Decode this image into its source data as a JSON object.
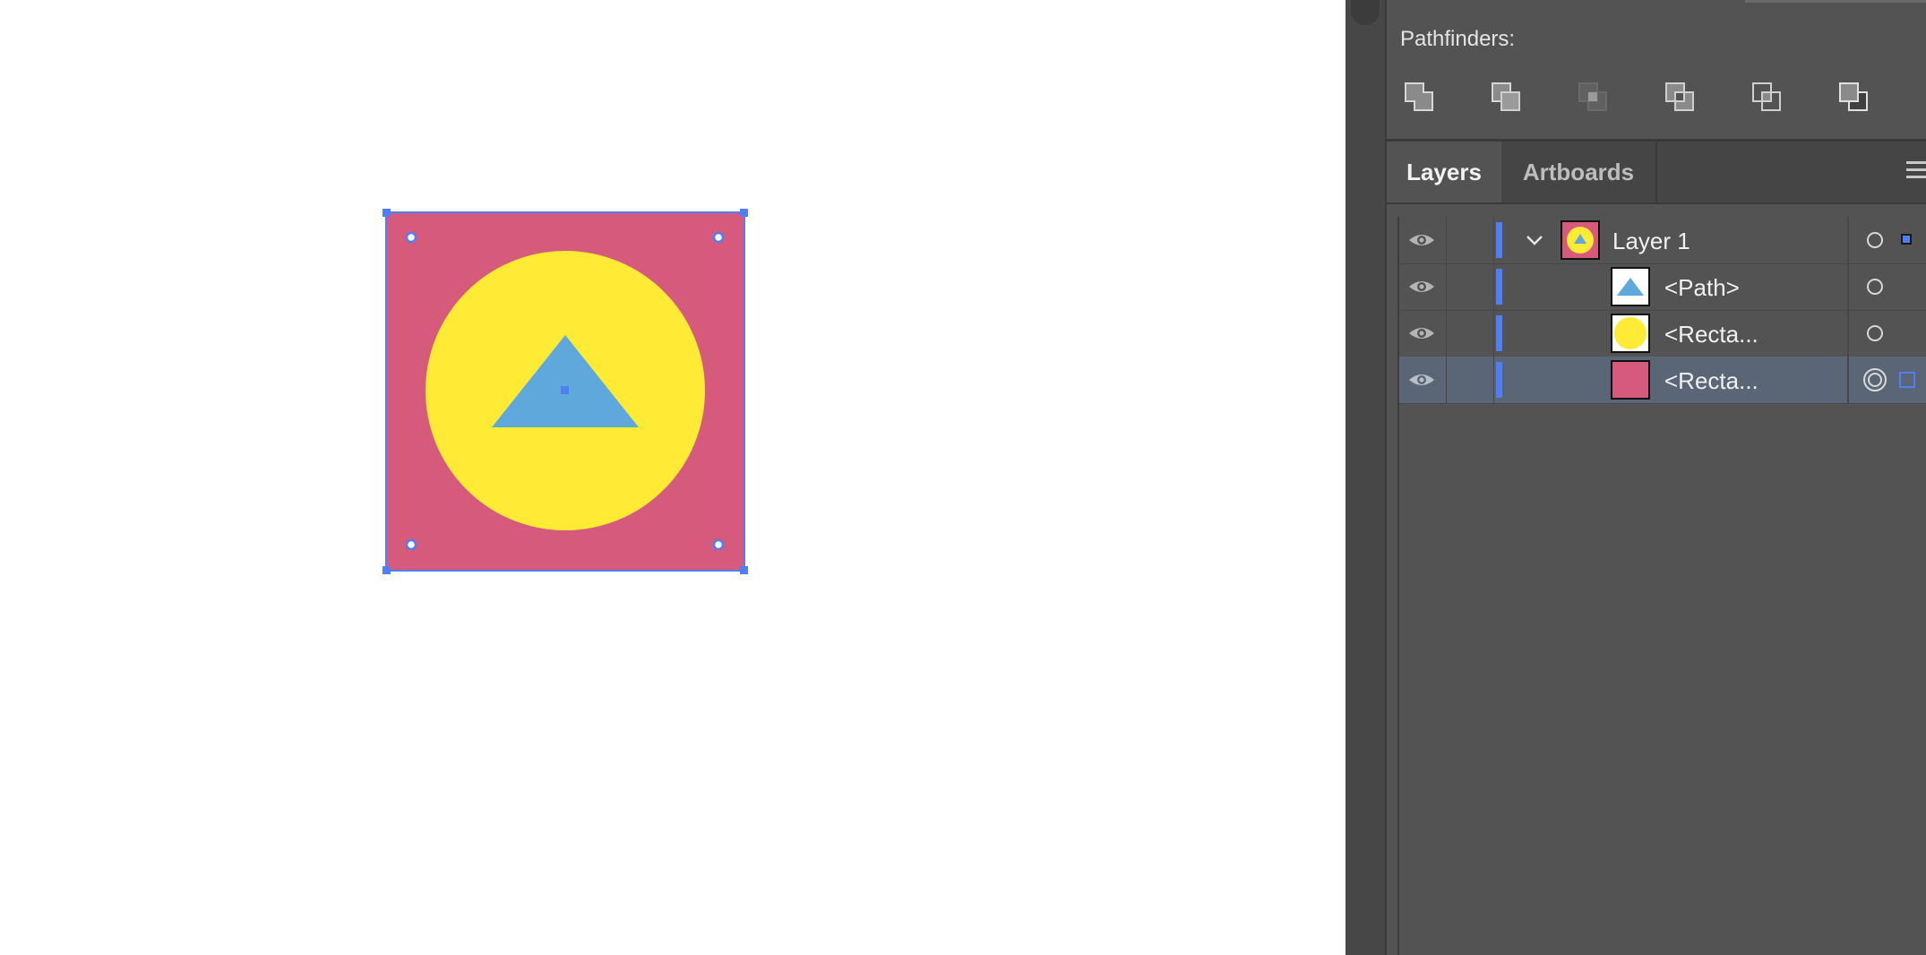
{
  "panel": {
    "pathfinders_label": "Pathfinders:",
    "pathfinder_buttons": [
      "unite",
      "minus-front",
      "intersect",
      "exclude",
      "divide",
      "trim"
    ],
    "tabs": [
      {
        "label": "Layers",
        "active": true
      },
      {
        "label": "Artboards",
        "active": false
      }
    ]
  },
  "layers": [
    {
      "name": "Layer 1",
      "kind": "layer",
      "expanded": true,
      "thumbnail": "artwork-composite",
      "selected": false
    },
    {
      "name": "<Path>",
      "kind": "path",
      "thumbnail": "blue-triangle",
      "selected": false
    },
    {
      "name": "<Recta...",
      "kind": "rectangle",
      "thumbnail": "yellow-circle",
      "selected": false
    },
    {
      "name": "<Recta...",
      "kind": "rectangle",
      "thumbnail": "pink-square",
      "selected": true
    }
  ],
  "colors": {
    "pink": "#d65a7b",
    "yellow": "#ffea36",
    "blue": "#5fa8dc",
    "selection": "#4f7ef5",
    "panel_bg": "#535353"
  }
}
